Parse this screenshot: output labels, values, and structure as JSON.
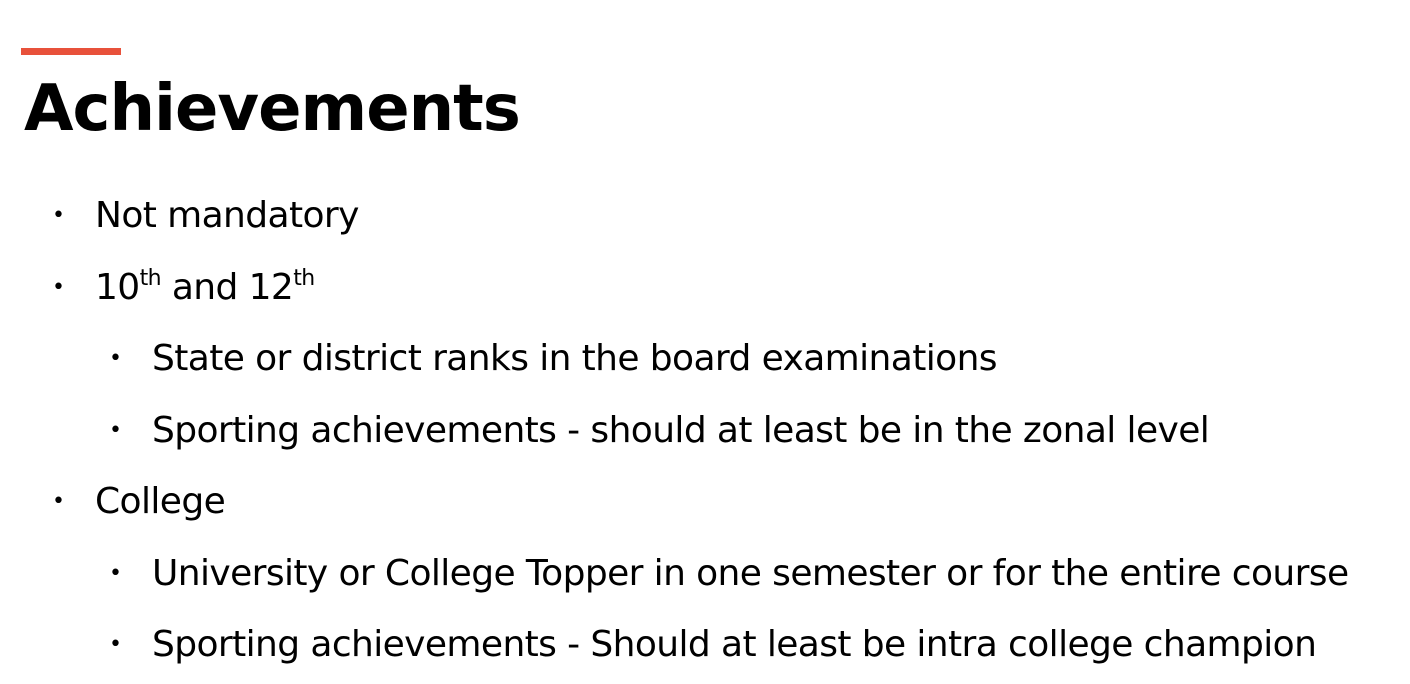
{
  "slide": {
    "title": "Achievements",
    "accent_color": "#e8513b",
    "bullet_glyph": "•",
    "items": [
      {
        "level": 1,
        "text": "Not mandatory"
      },
      {
        "level": 1,
        "parts": {
          "n1": "10",
          "s1": "th",
          "mid": " and 12",
          "s2": "th"
        }
      },
      {
        "level": 2,
        "text": "State or district ranks in the board examinations"
      },
      {
        "level": 2,
        "text": "Sporting achievements - should at least be in the zonal level"
      },
      {
        "level": 1,
        "text": "College"
      },
      {
        "level": 2,
        "text": "University or College Topper in one semester or for the entire course"
      },
      {
        "level": 2,
        "text": "Sporting achievements - Should at least be intra college champion"
      }
    ]
  }
}
